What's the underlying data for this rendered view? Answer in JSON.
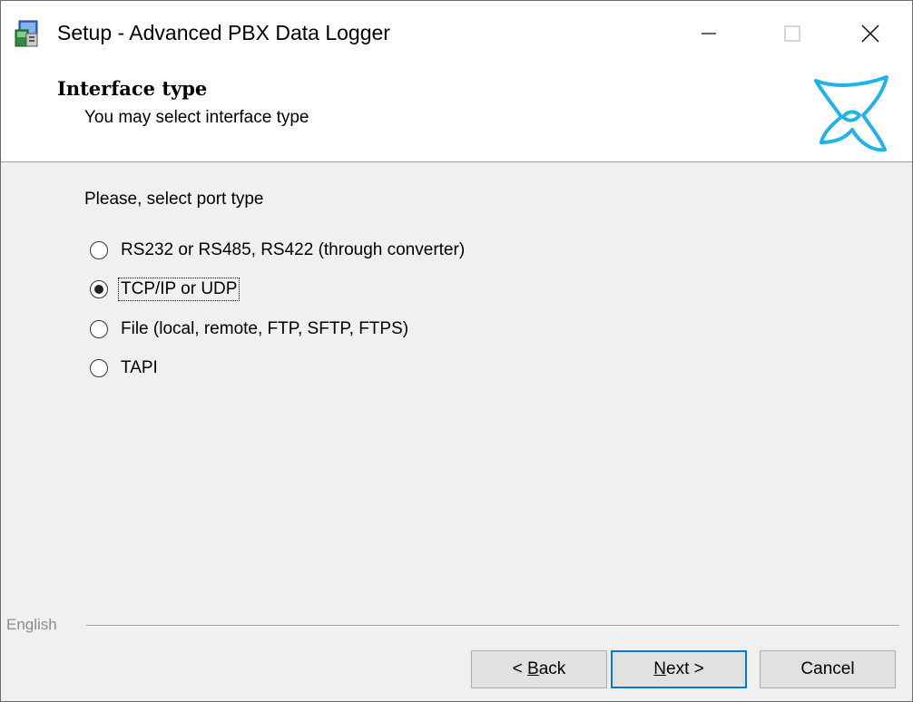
{
  "window": {
    "title": "Setup - Advanced PBX Data Logger",
    "app_icon": "setup-installer-icon",
    "controls": {
      "minimize": "minimize-icon",
      "maximize": "maximize-icon",
      "close": "close-icon"
    }
  },
  "header": {
    "title": "Interface type",
    "subtitle": "You may select interface type",
    "logo_icon": "propeller-logo-icon",
    "logo_color": "#1fb3e8"
  },
  "body": {
    "prompt": "Please, select port type",
    "options": [
      {
        "label": "RS232 or RS485, RS422 (through converter)",
        "selected": false
      },
      {
        "label": "TCP/IP or UDP",
        "selected": true
      },
      {
        "label": "File (local, remote, FTP, SFTP, FTPS)",
        "selected": false
      },
      {
        "label": "TAPI",
        "selected": false
      }
    ]
  },
  "footer": {
    "language": "English",
    "buttons": {
      "back": {
        "prefix": "< ",
        "mnemonic": "B",
        "rest": "ack"
      },
      "next": {
        "mnemonic": "N",
        "rest": "ext >"
      },
      "cancel": "Cancel"
    },
    "default_button_color": "#0078d7"
  }
}
